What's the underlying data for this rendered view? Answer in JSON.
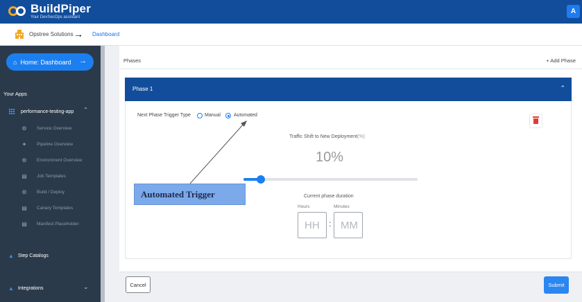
{
  "header": {
    "brand_name": "BuildPiper",
    "brand_tagline": "Your DevSecOps assistant",
    "user_initial": "A"
  },
  "breadcrumb": {
    "organization": "Opstree Solutions",
    "separator": "→",
    "current_page": "Dashboard"
  },
  "sidebar": {
    "home_button": "Home: Dashboard",
    "home_arrow": "→",
    "your_apps_title": "Your Apps",
    "app_name": "performance-testing-app",
    "items": [
      {
        "label": "Service Overview",
        "icon": "gear-icon"
      },
      {
        "label": "Pipeline Overview",
        "icon": "tools-icon"
      },
      {
        "label": "Environment Overview",
        "icon": "gear-icon"
      },
      {
        "label": "Job Templates",
        "icon": "document-icon"
      },
      {
        "label": "Build / Deploy",
        "icon": "gear-icon"
      },
      {
        "label": "Canary Templates",
        "icon": "document-icon"
      },
      {
        "label": "Manifest Placeholder",
        "icon": "document-icon"
      }
    ],
    "step_catalogs": "Step Catalogs",
    "integrations": "Integrations"
  },
  "main": {
    "phases_title": "Phases",
    "add_phase": "+ Add Phase",
    "phase": {
      "title": "Phase 1",
      "trigger_label": "Next Phase Trigger Type",
      "trigger_options": [
        "Manual",
        "Automated"
      ],
      "trigger_selected": "Automated",
      "traffic_label": "Traffic Shift to New Deployment",
      "traffic_unit": "(%)",
      "traffic_value": "10%",
      "traffic_percent": 10,
      "duration_label": "Current phase duration",
      "hours_label": "Hours",
      "minutes_label": "Minutes",
      "hours_placeholder": "HH",
      "minutes_placeholder": "MM",
      "time_separator": ":"
    },
    "cancel": "Cancel",
    "submit": "Submit"
  },
  "annotation": {
    "callout_text": "Automated Trigger"
  },
  "colors": {
    "header_bg": "#124d9b",
    "accent": "#1c7ff0",
    "sidebar_bg": "#2b3a4b",
    "delete": "#e53935",
    "callout_bg": "#7ca9ea"
  }
}
